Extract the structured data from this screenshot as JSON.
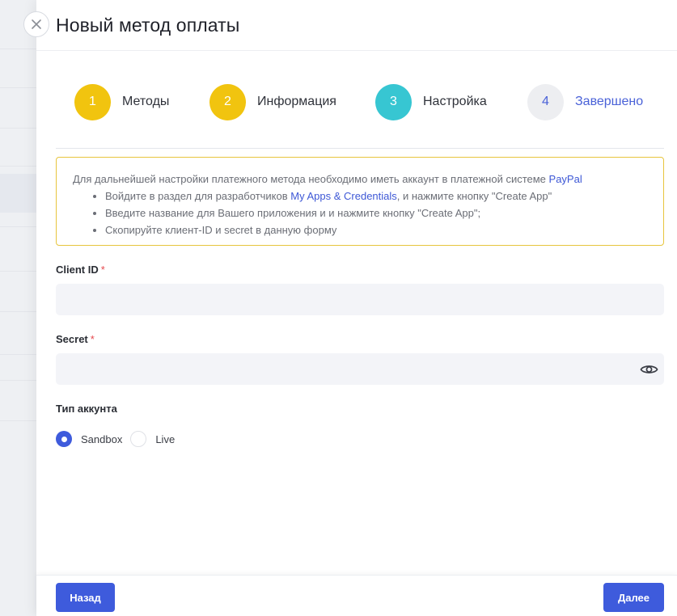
{
  "drawer": {
    "title": "Новый метод оплаты"
  },
  "stepper": {
    "steps": [
      {
        "number": "1",
        "label": "Методы",
        "state": "done"
      },
      {
        "number": "2",
        "label": "Информация",
        "state": "done"
      },
      {
        "number": "3",
        "label": "Настройка",
        "state": "active"
      },
      {
        "number": "4",
        "label": "Завершено",
        "state": "pending"
      }
    ]
  },
  "info": {
    "intro": "Для дальнейшей настройки платежного метода необходимо иметь аккаунт в платежной системе ",
    "intro_link": "PayPal",
    "item1_prefix": "Войдите в раздел для разработчиков ",
    "item1_link": "My Apps & Credentials",
    "item1_suffix": ", и нажмите кнопку \"Create App\"",
    "item2": "Введите название для Вашего приложения и и нажмите кнопку \"Create App\";",
    "item3": "Скопируйте клиент-ID и secret в данную форму"
  },
  "form": {
    "client_id": {
      "label": "Client ID",
      "required_mark": "*",
      "value": ""
    },
    "secret": {
      "label": "Secret",
      "required_mark": "*",
      "value": ""
    },
    "account_type": {
      "label": "Тип аккунта",
      "options": [
        {
          "label": "Sandbox",
          "checked": true
        },
        {
          "label": "Live",
          "checked": false
        }
      ]
    }
  },
  "footer": {
    "back_label": "Назад",
    "next_label": "Далее"
  },
  "colors": {
    "primary": "#3e5bdc",
    "step_done": "#f1c40f",
    "step_active": "#37c6d2",
    "step_pending": "#edeef1",
    "info_border": "#e7c53d",
    "required": "#e5484d"
  },
  "icons": {
    "close": "close-icon",
    "eye": "eye-icon"
  }
}
